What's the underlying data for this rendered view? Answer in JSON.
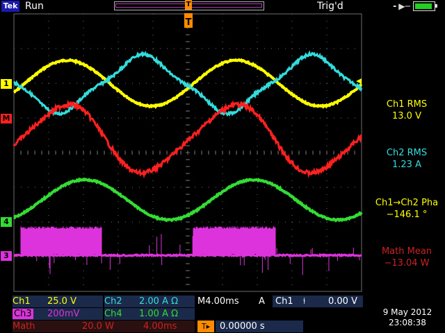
{
  "top_bar": {
    "logo": "Tek",
    "run_status": "Run",
    "trigger_status": "Trig'd",
    "trigger_marker": "T",
    "power_icon": "plug-icon",
    "battery_icon": "battery-icon"
  },
  "channel_markers": {
    "ch1": "1",
    "math": "M",
    "ch4": "4",
    "ch3": "3"
  },
  "colors": {
    "ch1": "#ffff00",
    "ch2": "#33dddd",
    "ch3": "#dd33dd",
    "ch4": "#33dd33",
    "math": "#ff2020",
    "trigger": "#ff8c00",
    "grid": "#6e6e6e"
  },
  "measurements": [
    {
      "label": "Ch1 RMS",
      "value": "13.0 V",
      "color": "#ffff00"
    },
    {
      "label": "Ch2 RMS",
      "value": "1.23 A",
      "color": "#33dddd"
    },
    {
      "label": "Ch1→Ch2 Pha",
      "value": "−146.1 °",
      "color": "#ffff00"
    },
    {
      "label": "Math Mean",
      "value": "−13.04 W",
      "color": "#cc2222"
    }
  ],
  "status": {
    "ch1_label": "Ch1",
    "ch1_scale": "25.0 V",
    "ch2_label": "Ch2",
    "ch2_scale": "2.00 A Ω",
    "horiz": "M4.00ms",
    "trig_mode": "A",
    "trig_source": "Ch1",
    "trig_slope": "⫮",
    "trig_level": "0.00 V",
    "ch3_label": "Ch3",
    "ch3_scale": "200mV",
    "ch4_label": "Ch4",
    "ch4_scale": "1.00 A Ω",
    "math_label": "Math",
    "math_scale": "20.0 W",
    "math_time": "4.00ms",
    "trig_pos_icon": "T▸",
    "trig_delay": "0.00000 s"
  },
  "date": "9 May 2012",
  "time": "23:08:38"
}
